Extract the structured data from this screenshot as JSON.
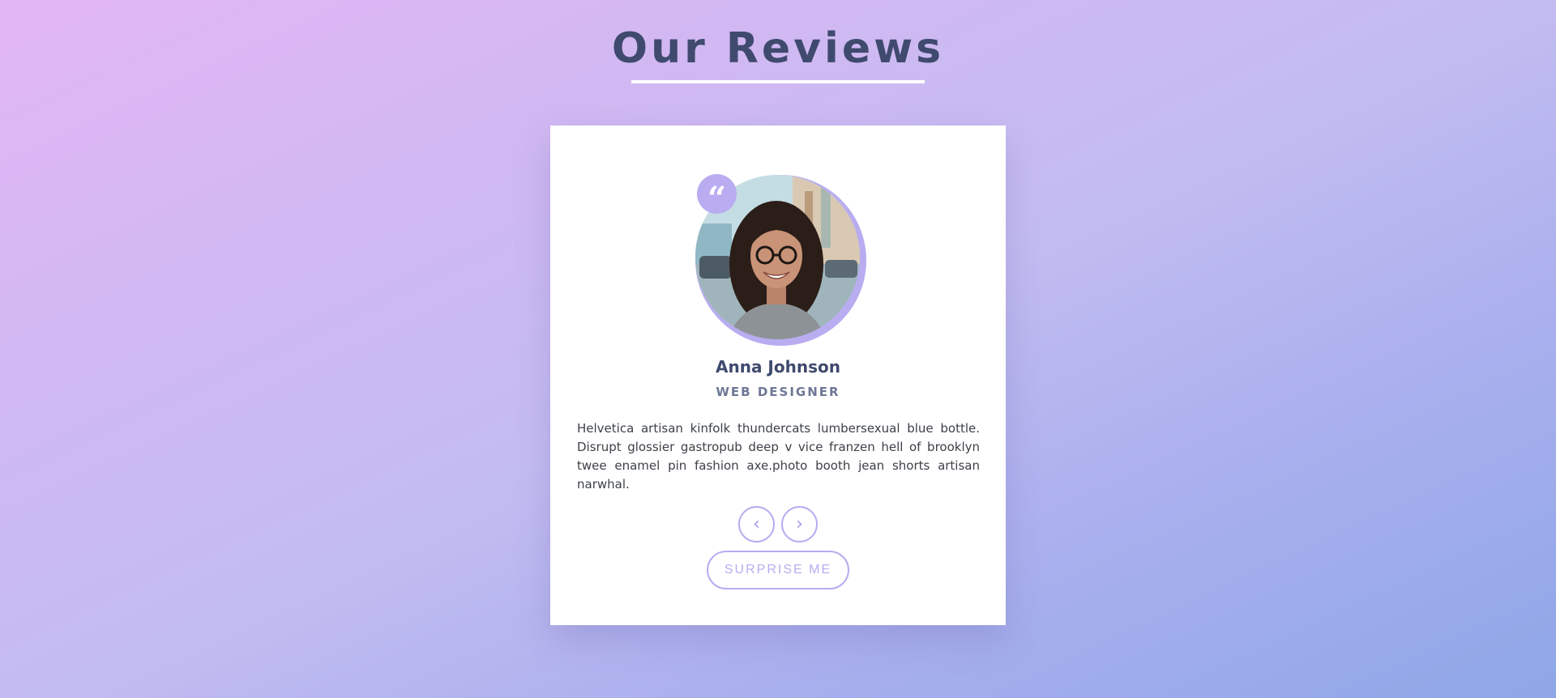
{
  "page": {
    "title": "Our Reviews"
  },
  "review": {
    "name": "Anna Johnson",
    "role": "WEB DESIGNER",
    "text": "Helvetica artisan kinfolk thundercats lumbersexual blue bottle. Disrupt glossier gastropub deep v vice franzen hell of brooklyn twee enamel pin fashion axe.photo booth jean shorts artisan narwhal.",
    "quote_icon": "quote-icon",
    "avatar_description_icon": "avatar-photo"
  },
  "controls": {
    "prev_icon": "chevron-left-icon",
    "next_icon": "chevron-right-icon",
    "prev_glyph": "‹",
    "next_glyph": "›",
    "surprise_label": "SURPRISE ME"
  },
  "colors": {
    "accent": "#b9acf0",
    "heading": "#3f4a6e",
    "subheading": "#6e7796",
    "background_start": "#e2b6f5",
    "background_end": "#8ea6e7"
  }
}
